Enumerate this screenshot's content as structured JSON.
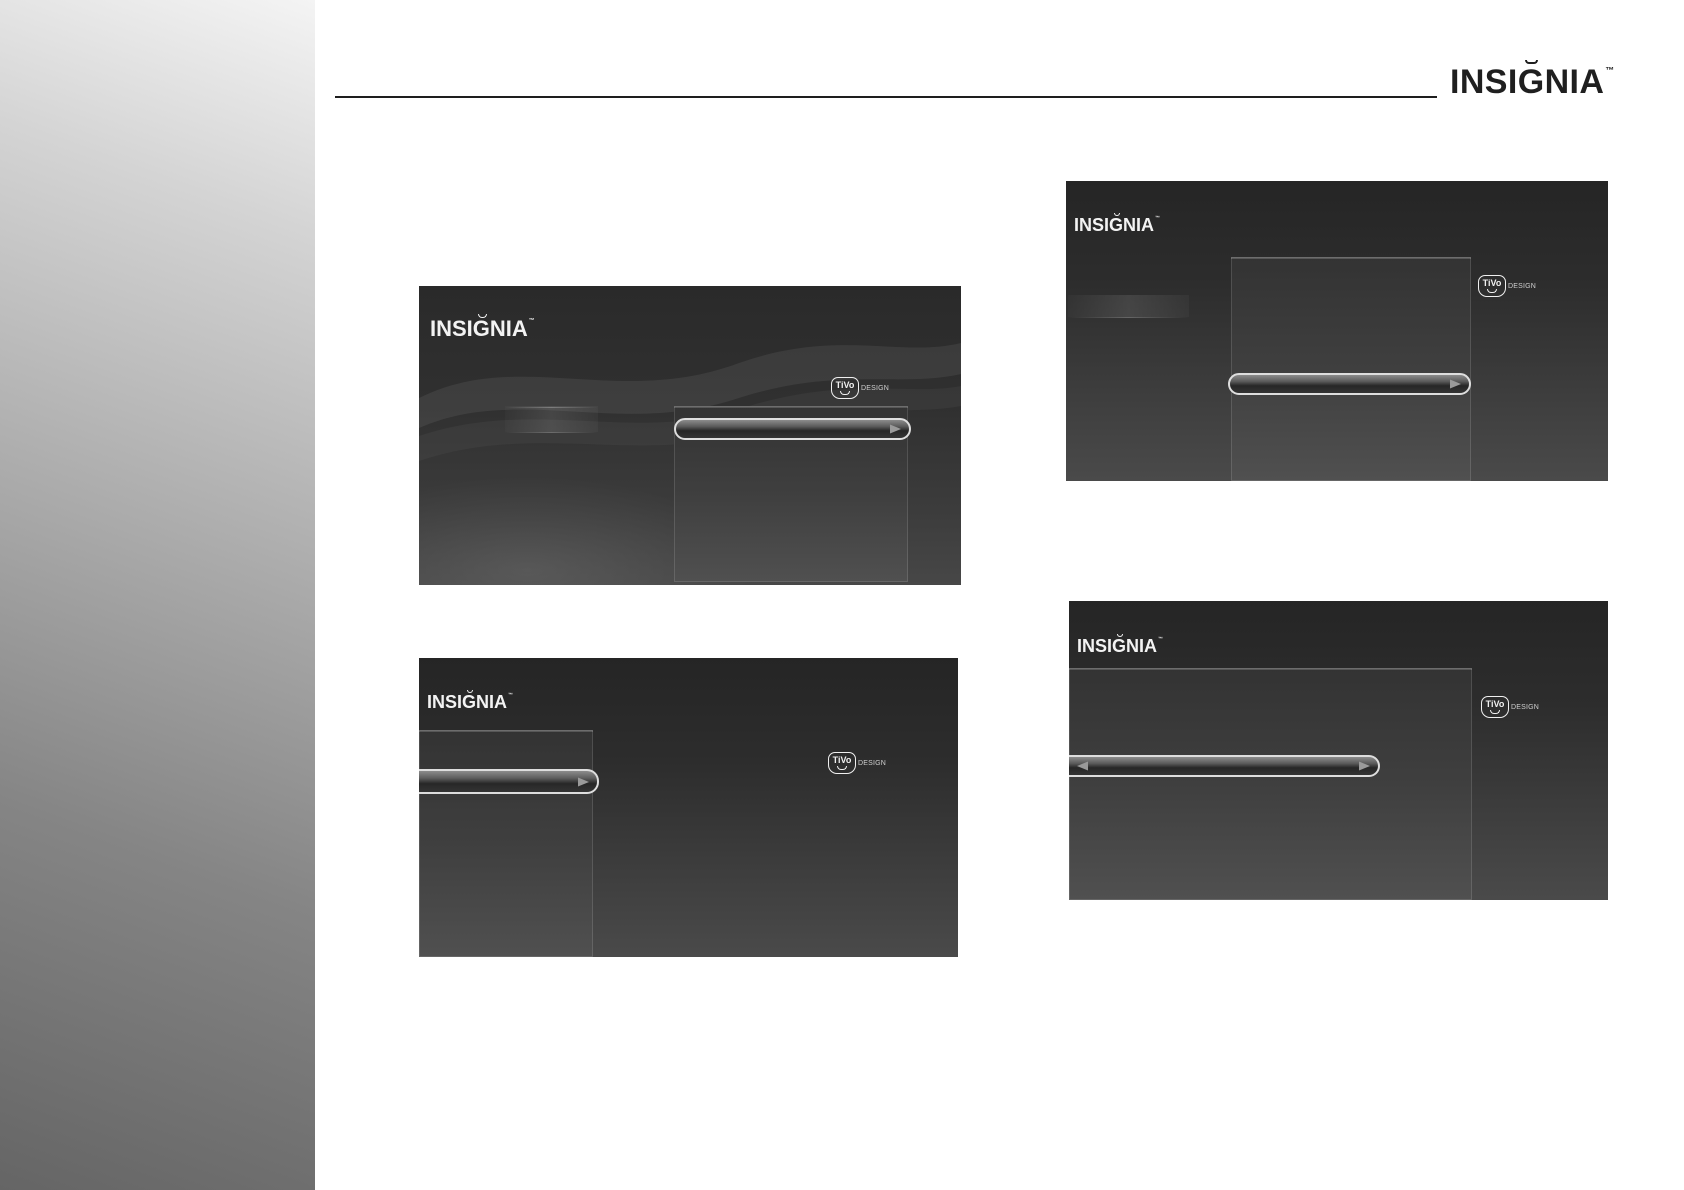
{
  "header": {
    "logo_text": "INSIGNIA",
    "logo_tm": "™"
  },
  "screens": [
    {
      "logo_text": "INSIGNIA",
      "logo_tm": "™",
      "tivo_text": "TiVo",
      "tivo_tag": "DESIGN"
    },
    {
      "logo_text": "INSIGNIA",
      "logo_tm": "™",
      "tivo_text": "TiVo",
      "tivo_tag": "DESIGN"
    },
    {
      "logo_text": "INSIGNIA",
      "logo_tm": "™",
      "tivo_text": "TiVo",
      "tivo_tag": "DESIGN"
    },
    {
      "logo_text": "INSIGNIA",
      "logo_tm": "™",
      "tivo_text": "TiVo",
      "tivo_tag": "DESIGN"
    }
  ],
  "icons": {
    "right_arrow": "right-arrow-icon",
    "left_arrow": "left-arrow-icon",
    "tivo": "tivo-logo-icon"
  },
  "colors": {
    "page_background": "#ffffff",
    "rule": "#1e1e1e",
    "screen_dark": "#252525",
    "screen_light": "#4a4a4a",
    "highlight_border": "#dedede",
    "arrow": "#9a9a9a"
  }
}
